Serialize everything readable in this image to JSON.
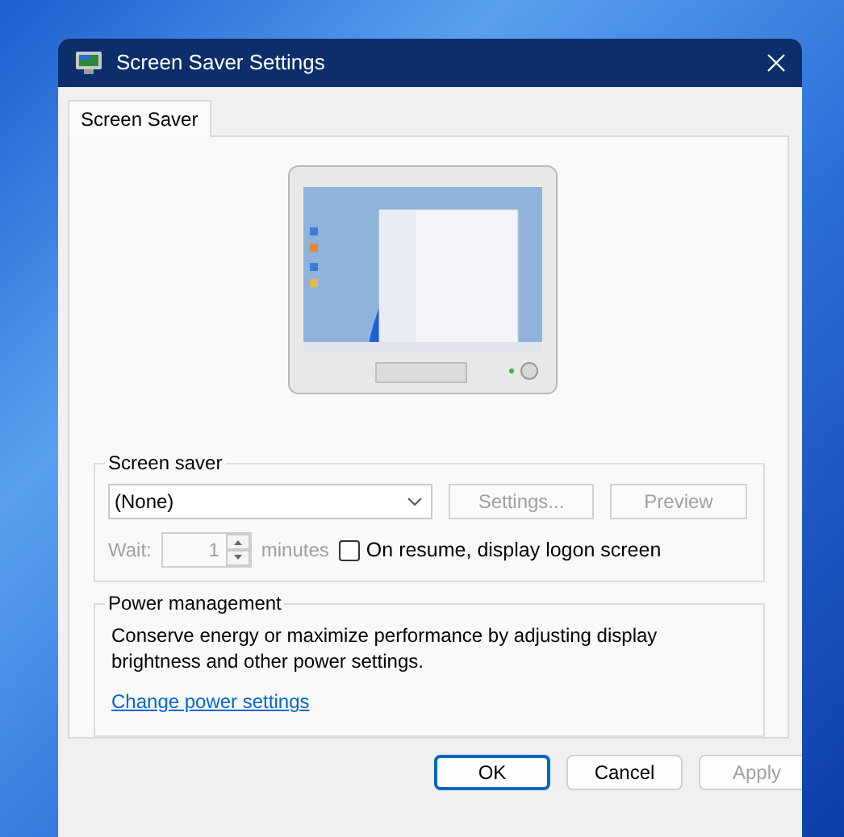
{
  "window": {
    "title": "Screen Saver Settings"
  },
  "tabs": [
    {
      "label": "Screen Saver",
      "selected": true
    }
  ],
  "screen_saver": {
    "legend": "Screen saver",
    "selection": "(None)",
    "buttons": [
      {
        "label": "Settings...",
        "disabled": true
      },
      {
        "label": "Preview",
        "disabled": true
      }
    ],
    "wait": {
      "label": "Wait:",
      "value": "1",
      "unit": "minutes",
      "disabled": true
    },
    "logon": {
      "label": "On resume, display logon screen",
      "checked": false
    }
  },
  "power": {
    "legend": "Power management",
    "description": "Conserve energy or maximize performance by adjusting display brightness and other power settings.",
    "link": "Change power settings"
  },
  "buttons": [
    {
      "label": "OK",
      "default": true,
      "disabled": false
    },
    {
      "label": "Cancel",
      "default": false,
      "disabled": false
    },
    {
      "label": "Apply",
      "default": false,
      "disabled": true
    }
  ]
}
